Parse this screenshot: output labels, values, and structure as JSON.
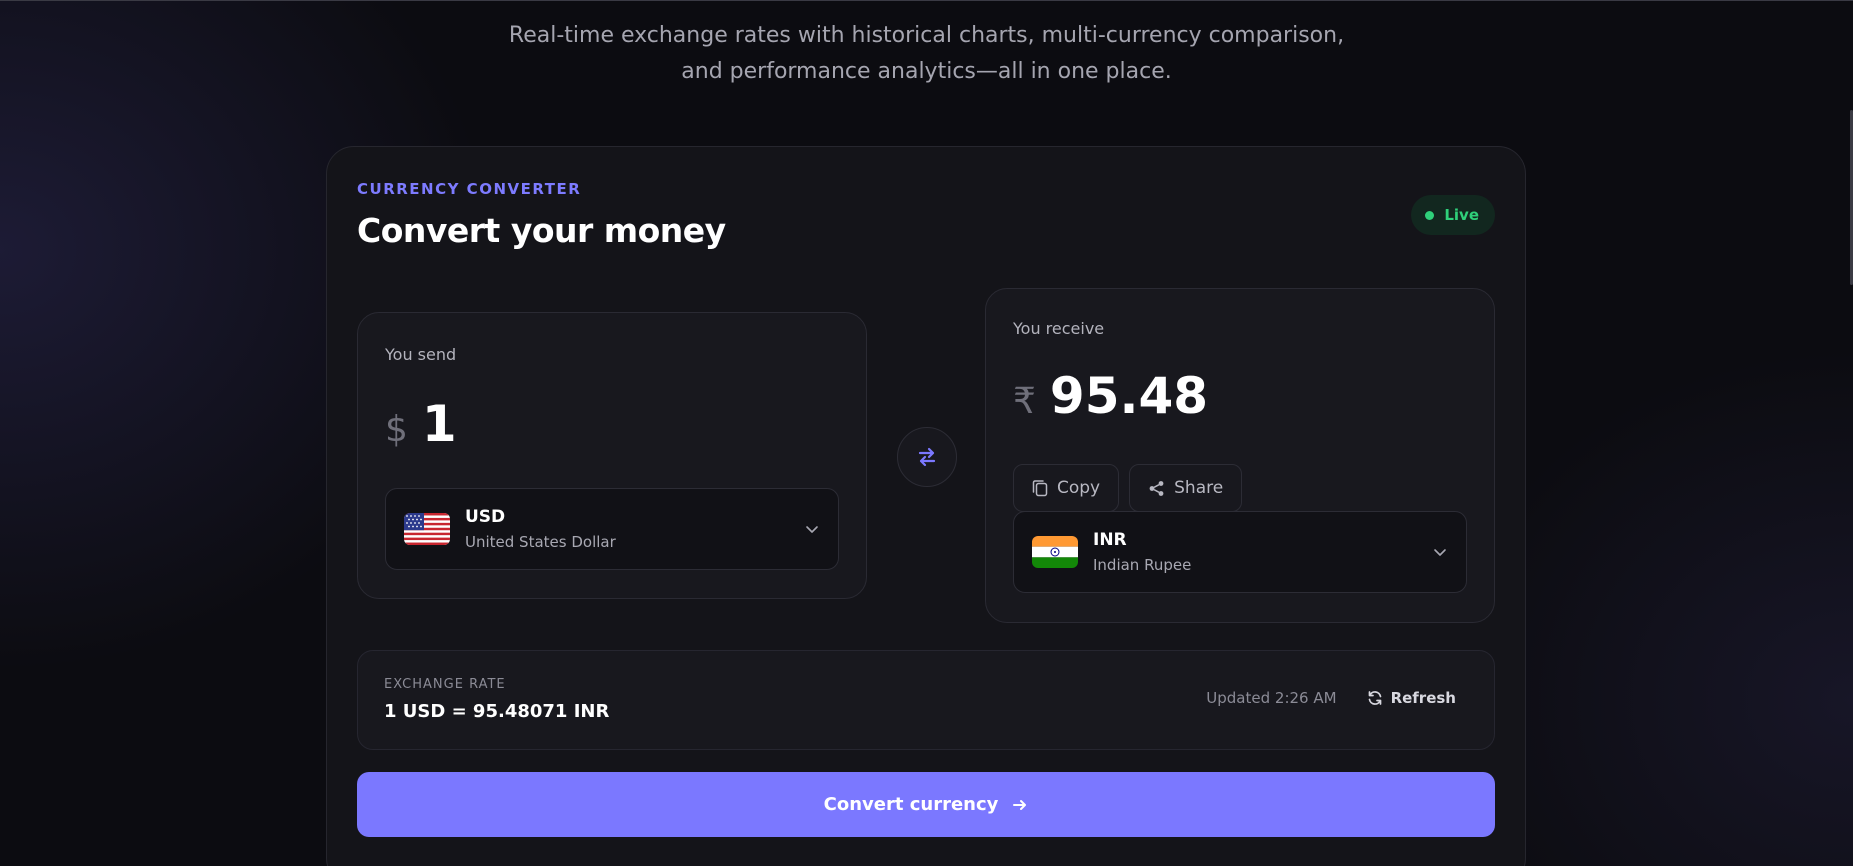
{
  "hero": {
    "tagline_line1": "Real-time exchange rates with historical charts, multi-currency comparison,",
    "tagline_line2": "and performance analytics—all in one place."
  },
  "converter": {
    "eyebrow": "CURRENCY CONVERTER",
    "title": "Convert your money",
    "status": "Live",
    "send": {
      "label": "You send",
      "symbol": "$",
      "amount": "1",
      "currency_code": "USD",
      "currency_name": "United States Dollar",
      "flag_icon": "us-flag-icon"
    },
    "receive": {
      "label": "You receive",
      "symbol": "₹",
      "amount": "95.48",
      "copy_label": "Copy",
      "share_label": "Share",
      "currency_code": "INR",
      "currency_name": "Indian Rupee",
      "flag_icon": "india-flag-icon"
    },
    "rate": {
      "label": "EXCHANGE RATE",
      "value": "1 USD = 95.48071 INR",
      "updated": "Updated 2:26 AM",
      "refresh_label": "Refresh"
    },
    "convert_label": "Convert currency"
  },
  "colors": {
    "accent": "#7b78ff",
    "live": "#2fd07a",
    "background": "#0c0c11",
    "card": "#141419"
  }
}
